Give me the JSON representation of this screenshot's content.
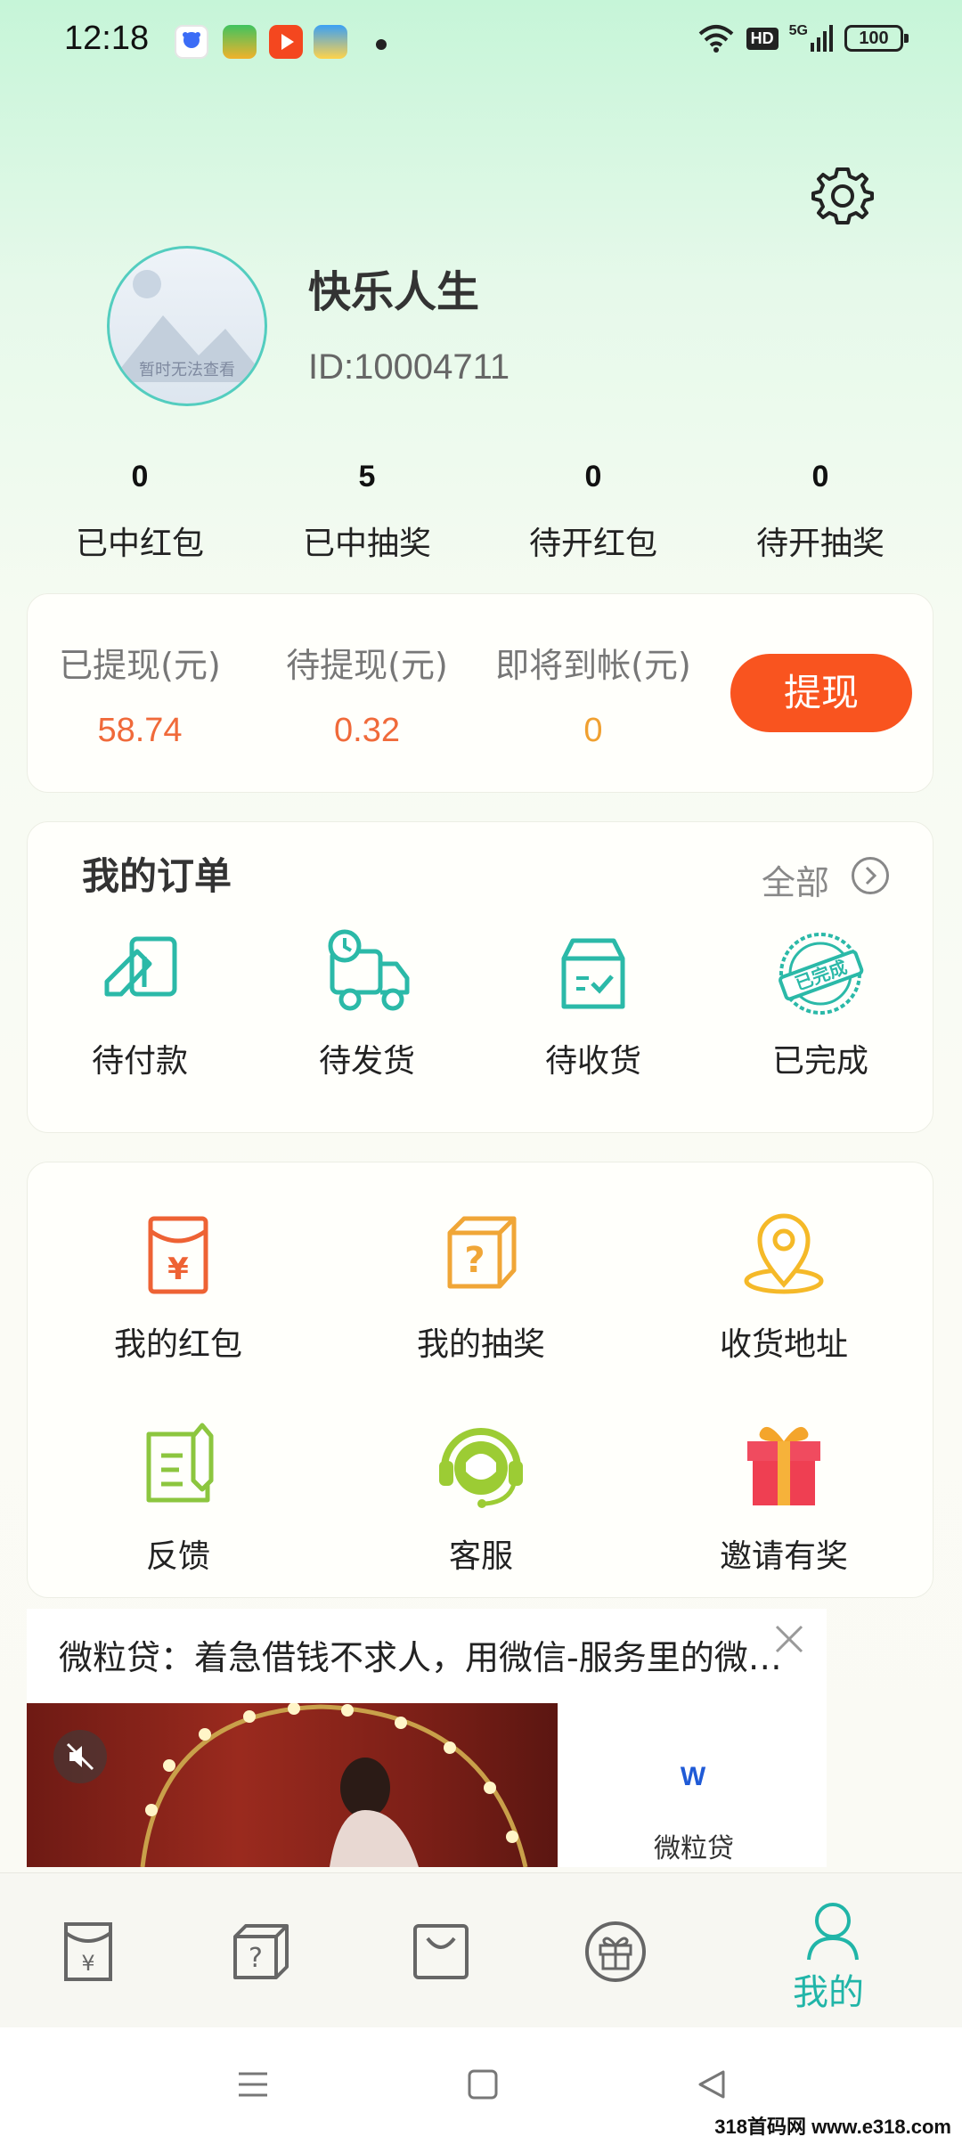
{
  "status_bar": {
    "time": "12:18",
    "network_badge": "HD",
    "signal_type": "5G",
    "battery_level": "100"
  },
  "profile": {
    "avatar_placeholder": "暂时无法查看",
    "username": "快乐人生",
    "user_id": "ID:10004711"
  },
  "stats": [
    {
      "value": "0",
      "label": "已中红包"
    },
    {
      "value": "5",
      "label": "已中抽奖"
    },
    {
      "value": "0",
      "label": "待开红包"
    },
    {
      "value": "0",
      "label": "待开抽奖"
    }
  ],
  "withdraw": {
    "columns": [
      {
        "label": "已提现(元)",
        "value": "58.74",
        "color": "#f06a3a"
      },
      {
        "label": "待提现(元)",
        "value": "0.32",
        "color": "#f06a3a"
      },
      {
        "label": "即将到帐(元)",
        "value": "0",
        "color": "#f0a030"
      }
    ],
    "button_label": "提现"
  },
  "orders": {
    "title": "我的订单",
    "all_label": "全部",
    "stamp_text": "已完成",
    "items": [
      {
        "label": "待付款",
        "icon": "wallet-icon"
      },
      {
        "label": "待发货",
        "icon": "delivery-truck-icon"
      },
      {
        "label": "待收货",
        "icon": "package-box-icon"
      },
      {
        "label": "已完成",
        "icon": "completed-stamp-icon"
      }
    ]
  },
  "services": {
    "red_packet_symbol": "¥",
    "items": [
      {
        "label": "我的红包",
        "icon": "red-packet-icon"
      },
      {
        "label": "我的抽奖",
        "icon": "lottery-box-icon"
      },
      {
        "label": "收货地址",
        "icon": "location-pin-icon"
      },
      {
        "label": "反馈",
        "icon": "feedback-icon"
      },
      {
        "label": "客服",
        "icon": "customer-service-icon"
      },
      {
        "label": "邀请有奖",
        "icon": "gift-icon"
      }
    ]
  },
  "ad": {
    "text": "微粒贷：着急借钱不求人，用微信-服务里的微…",
    "brand_name": "微粒贷",
    "brand_logo_letter": "W"
  },
  "bottom_nav": {
    "items": [
      {
        "icon": "red-packet-nav-icon",
        "symbol": "¥"
      },
      {
        "icon": "lottery-nav-icon",
        "symbol": "?"
      },
      {
        "icon": "shopping-bag-nav-icon"
      },
      {
        "icon": "gift-nav-icon"
      },
      {
        "icon": "profile-nav-icon",
        "label": "我的",
        "active": true
      }
    ],
    "active_color": "#21b5a8"
  },
  "watermark": "318首码网 www.e318.com",
  "colors": {
    "accent_teal": "#21b5a8",
    "withdraw_button": "#f9541f",
    "amount_orange": "#f06a3a",
    "pending_amount": "#f0a030"
  }
}
